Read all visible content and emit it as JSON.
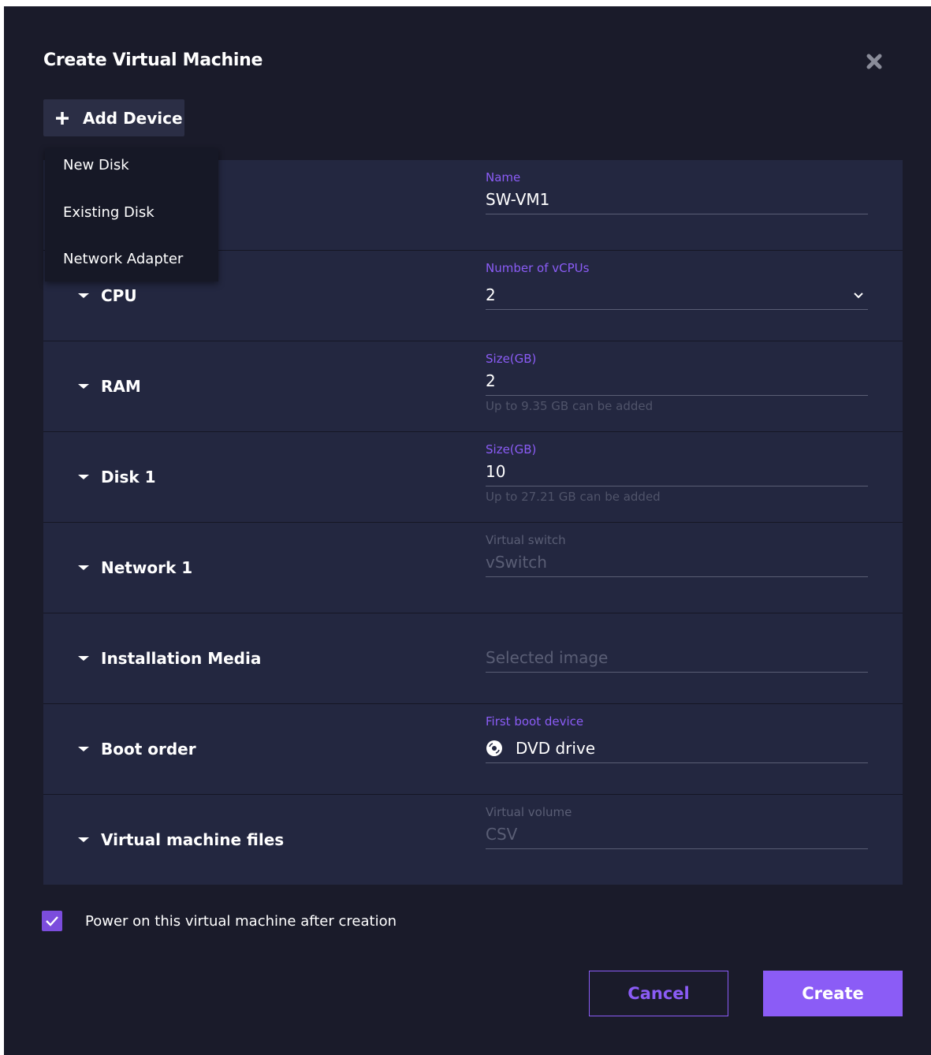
{
  "dialog": {
    "title": "Create Virtual Machine",
    "add_device_label": "Add Device"
  },
  "add_menu": {
    "items": [
      {
        "label": "New Disk"
      },
      {
        "label": "Existing Disk"
      },
      {
        "label": "Network Adapter"
      }
    ]
  },
  "rows": {
    "name": {
      "field_label": "Name",
      "value": "SW-VM1"
    },
    "cpu": {
      "title": "CPU",
      "field_label": "Number of vCPUs",
      "value": "2"
    },
    "ram": {
      "title": "RAM",
      "field_label": "Size(GB)",
      "value": "2",
      "hint": "Up to 9.35 GB can be added"
    },
    "disk1": {
      "title": "Disk 1",
      "field_label": "Size(GB)",
      "value": "10",
      "hint": "Up to 27.21 GB can be added"
    },
    "network1": {
      "title": "Network 1",
      "field_label": "Virtual switch",
      "placeholder": "vSwitch"
    },
    "install_media": {
      "title": "Installation Media",
      "placeholder": "Selected image"
    },
    "boot_order": {
      "title": "Boot order",
      "field_label": "First boot device",
      "value": "DVD drive"
    },
    "vm_files": {
      "title": "Virtual machine files",
      "field_label": "Virtual volume",
      "placeholder": "CSV"
    }
  },
  "power_on": {
    "label": "Power on this virtual machine after creation",
    "checked": true
  },
  "buttons": {
    "cancel": "Cancel",
    "create": "Create"
  },
  "icons": {
    "close": "close-icon",
    "add": "plus-icon",
    "dropdown": "chevron-down-icon",
    "boot_device": "dvd-icon",
    "checkbox": "checkmark-icon"
  },
  "colors": {
    "accent": "#8b5cf6",
    "background": "#1a1b2a",
    "panel": "#232740"
  }
}
